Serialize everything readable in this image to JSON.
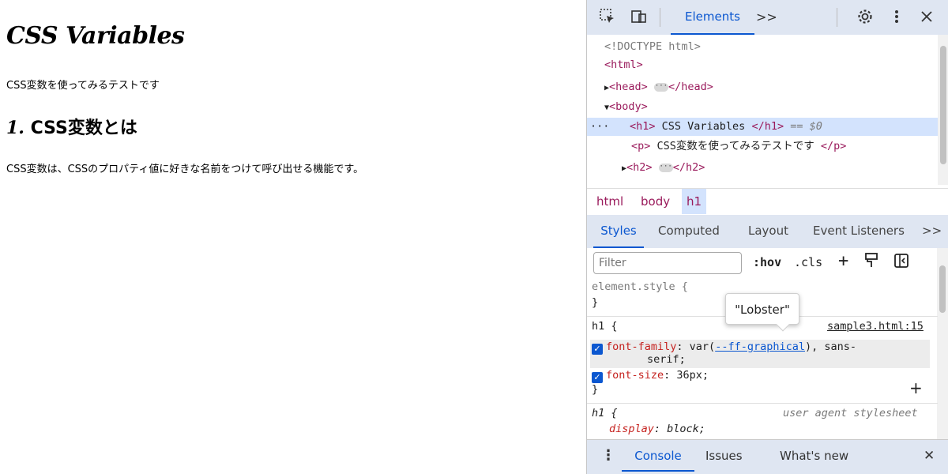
{
  "page": {
    "h1": "CSS Variables",
    "p1": "CSS変数を使ってみるテストです",
    "h2_num": "1.",
    "h2_text": " CSS変数とは",
    "p2": "CSS変数は、CSSのプロパティ値に好きな名前をつけて呼び出せる機能です。"
  },
  "devtools": {
    "toolbar": {
      "inspect_icon": "inspect-element-icon",
      "device_icon": "device-toolbar-icon",
      "active_tab": "Elements",
      "more_tabs": ">>",
      "settings_icon": "gear-icon",
      "menu_icon": "kebab-menu-icon",
      "close_icon": "close-icon"
    },
    "dom": {
      "doctype": "<!DOCTYPE html>",
      "html_open": "<html>",
      "head_open": "<head>",
      "head_close": "</head>",
      "body_open": "<body>",
      "sel_prefix": "···",
      "h1_open": "<h1>",
      "h1_text": " CSS Variables ",
      "h1_close": "</h1>",
      "h1_eq": " == $0",
      "p_open": "<p>",
      "p_text": " CSS変数を使ってみるテストです ",
      "p_close": "</p>",
      "h2_open": "<h2>",
      "h2_close": "</h2>"
    },
    "breadcrumbs": [
      "html",
      "body",
      "h1"
    ],
    "styles_tabs": [
      "Styles",
      "Computed",
      "Layout",
      "Event Listeners",
      ">>"
    ],
    "filter": {
      "placeholder": "Filter",
      "hov": ":hov",
      "cls": ".cls",
      "plus": "+"
    },
    "rules": {
      "element_style": "element.style {",
      "close_brace": "}",
      "h1_selector": "h1 {",
      "source": "sample3.html:15",
      "ff_prop": "font-family",
      "ff_var": "--ff-graphical",
      "ff_rest": "), sans-",
      "ff_wrap": "serif;",
      "fs_prop": "font-size",
      "fs_val": ": 36px;",
      "ua_selector": "h1 {",
      "ua_source": "user agent stylesheet",
      "display_prop": "display",
      "display_val": ": block;"
    },
    "tooltip": "\"Lobster\"",
    "drawer": {
      "console": "Console",
      "issues": "Issues",
      "whats_new": "What's new",
      "close": "✕"
    },
    "colors": {
      "accent": "#0b57d0",
      "tag": "#9a1b5c",
      "property": "#c5221f",
      "selection": "#d3e3fd",
      "toolbar_bg": "#dfe6f2"
    }
  }
}
